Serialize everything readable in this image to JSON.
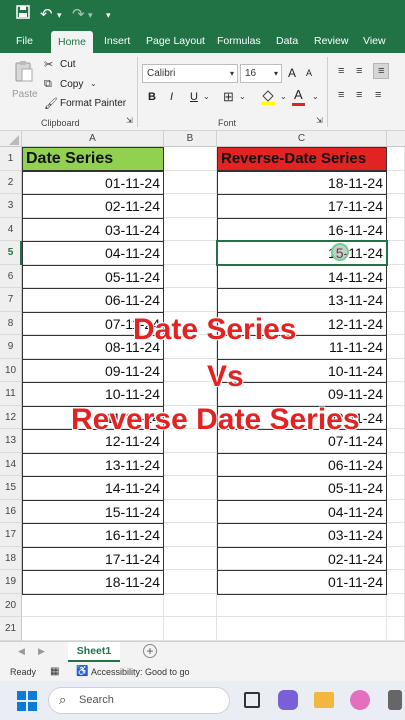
{
  "titlebar": {
    "save_icon": "save-icon",
    "undo_icon": "undo-icon",
    "redo_icon": "redo-icon"
  },
  "tabs": [
    {
      "label": "File"
    },
    {
      "label": "Home"
    },
    {
      "label": "Insert"
    },
    {
      "label": "Page Layout"
    },
    {
      "label": "Formulas"
    },
    {
      "label": "Data"
    },
    {
      "label": "Review"
    },
    {
      "label": "View"
    }
  ],
  "ribbon": {
    "paste": "Paste",
    "cut": "Cut",
    "copy": "Copy",
    "format_painter": "Format Painter",
    "clipboard_label": "Clipboard",
    "font_name": "Calibri",
    "font_size": "16",
    "bold": "B",
    "italic": "I",
    "underline": "U",
    "font_label": "Font",
    "grow_font": "A",
    "shrink_font": "A",
    "font_color_letter": "A"
  },
  "columns": [
    "A",
    "B",
    "C"
  ],
  "rows": [
    "1",
    "2",
    "3",
    "4",
    "5",
    "6",
    "7",
    "8",
    "9",
    "10",
    "11",
    "12",
    "13",
    "14",
    "15",
    "16",
    "17",
    "18",
    "19",
    "20",
    "21"
  ],
  "headers": {
    "a": "Date Series",
    "c": "Reverse-Date Series"
  },
  "date_series": [
    "01-11-24",
    "02-11-24",
    "03-11-24",
    "04-11-24",
    "05-11-24",
    "06-11-24",
    "07-11-24",
    "08-11-24",
    "09-11-24",
    "10-11-24",
    "11-11-24",
    "12-11-24",
    "13-11-24",
    "14-11-24",
    "15-11-24",
    "16-11-24",
    "17-11-24",
    "18-11-24"
  ],
  "reverse_series": [
    "18-11-24",
    "17-11-24",
    "16-11-24",
    "15-11-24",
    "14-11-24",
    "13-11-24",
    "12-11-24",
    "11-11-24",
    "10-11-24",
    "09-11-24",
    "08-11-24",
    "07-11-24",
    "06-11-24",
    "05-11-24",
    "04-11-24",
    "03-11-24",
    "02-11-24",
    "01-11-24"
  ],
  "overlay": {
    "line1": "Date Series",
    "line2": "Vs",
    "line3": "Reverse Date Series"
  },
  "sheet": {
    "name": "Sheet1",
    "add": "+"
  },
  "status": {
    "ready": "Ready",
    "accessibility": "Accessibility: Good to go"
  },
  "taskbar": {
    "search_placeholder": "Search"
  },
  "colors": {
    "excel_green": "#217346",
    "header_green": "#92d050",
    "header_red": "#e32222",
    "overlay_red": "#e32222"
  }
}
